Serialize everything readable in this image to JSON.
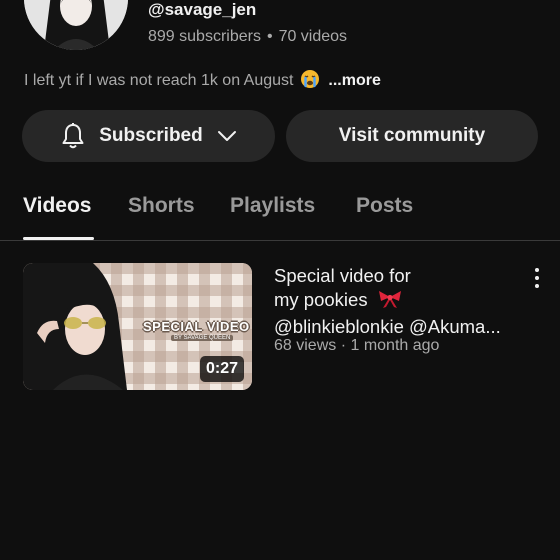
{
  "channel": {
    "handle": "@savage_jen",
    "subscribers": "899 subscribers",
    "separator": "•",
    "videos": "70 videos",
    "bio": "I left yt if I was not reach 1k on August",
    "bio_emoji": "crying-face-emoji",
    "more_label": "...more"
  },
  "actions": {
    "subscribed_label": "Subscribed",
    "community_label": "Visit community",
    "bell_icon": "bell-icon",
    "chevron_icon": "chevron-down-icon"
  },
  "tabs": [
    {
      "label": "Videos",
      "active": true
    },
    {
      "label": "Shorts",
      "active": false
    },
    {
      "label": "Playlists",
      "active": false
    },
    {
      "label": "Posts",
      "active": false
    }
  ],
  "videos": [
    {
      "title_line1": "Special video for",
      "title_line2": "my pookies",
      "title_emoji": "ribbon-emoji",
      "title_line3": "@blinkieblonkie @Akuma...",
      "meta": "68 views · 1 month ago",
      "duration": "0:27",
      "thumb_text": "SPECIAL VIDEO",
      "thumb_subtext": "BY SAVAGE QUEEN"
    }
  ],
  "colors": {
    "background": "#0f0f0f",
    "pill": "#272727",
    "text_primary": "#f1f1f1",
    "text_secondary": "#aaaaaa",
    "ribbon": "#e0243b"
  }
}
